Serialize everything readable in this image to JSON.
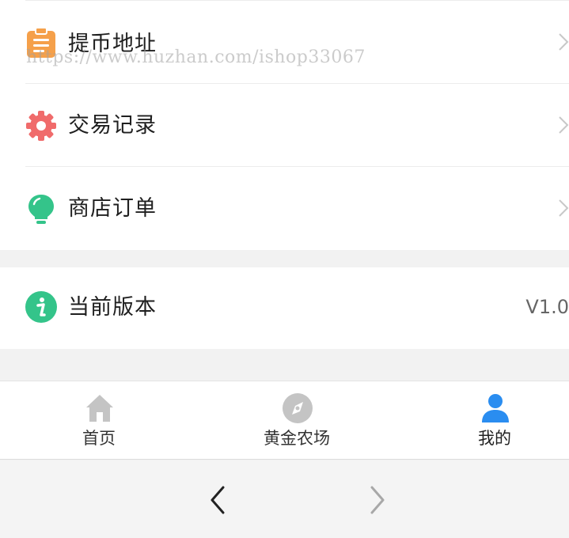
{
  "menu": {
    "items": [
      {
        "label": "提币地址",
        "icon": "clipboard-icon",
        "color": "#f5a04a"
      },
      {
        "label": "交易记录",
        "icon": "gear-icon",
        "color": "#f06b6b"
      },
      {
        "label": "商店订单",
        "icon": "lightbulb-icon",
        "color": "#34c48a"
      }
    ],
    "version": {
      "label": "当前版本",
      "icon": "info-icon",
      "color": "#34c48a",
      "value": "V1.0"
    }
  },
  "watermark": "https://www.huzhan.com/ishop33067",
  "tabbar": {
    "tabs": [
      {
        "label": "首页",
        "icon": "home-icon",
        "active": false
      },
      {
        "label": "黄金农场",
        "icon": "compass-icon",
        "active": false
      },
      {
        "label": "我的",
        "icon": "user-icon",
        "active": true
      }
    ],
    "active_color": "#2a8df0",
    "inactive_color": "#c4c4c4"
  },
  "browser": {
    "back": "back-icon",
    "forward": "forward-icon"
  }
}
